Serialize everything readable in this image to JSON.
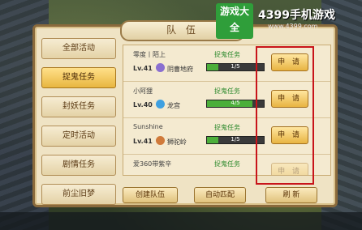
{
  "panel": {
    "title": "队 伍"
  },
  "sidebar": {
    "items": [
      {
        "label": "全部活动"
      },
      {
        "label": "捉鬼任务"
      },
      {
        "label": "封妖任务"
      },
      {
        "label": "定时活动"
      },
      {
        "label": "剧情任务"
      },
      {
        "label": "前尘旧梦"
      }
    ]
  },
  "rows": [
    {
      "name": "零度丨陌上",
      "level": "Lv.41",
      "location": "阴曹地府",
      "task": "捉鬼任务",
      "progress": "1/5",
      "progress_frac": 0.2,
      "apply": "申 请"
    },
    {
      "name": "小阿狸",
      "level": "Lv.40",
      "location": "龙宫",
      "task": "捉鬼任务",
      "progress": "4/5",
      "progress_frac": 0.8,
      "apply": "申 请"
    },
    {
      "name": "Sunshine",
      "level": "Lv.41",
      "location": "狮驼岭",
      "task": "捉鬼任务",
      "progress": "1/5",
      "progress_frac": 0.2,
      "apply": "申 请"
    },
    {
      "name": "爱360带紫辛",
      "level": "",
      "location": "",
      "task": "捉鬼任务",
      "progress": "",
      "progress_frac": 0,
      "apply": "申 请"
    }
  ],
  "buttons": {
    "create": "创建队伍",
    "auto": "自动匹配",
    "refresh": "刷 新"
  },
  "logo": {
    "box": "游戏大全",
    "main": "4399手机游戏",
    "sub": "www.4399.com"
  },
  "colors": {
    "accent": "#e8b442",
    "highlight": "#c8141a",
    "progress": "#4caf3a"
  }
}
